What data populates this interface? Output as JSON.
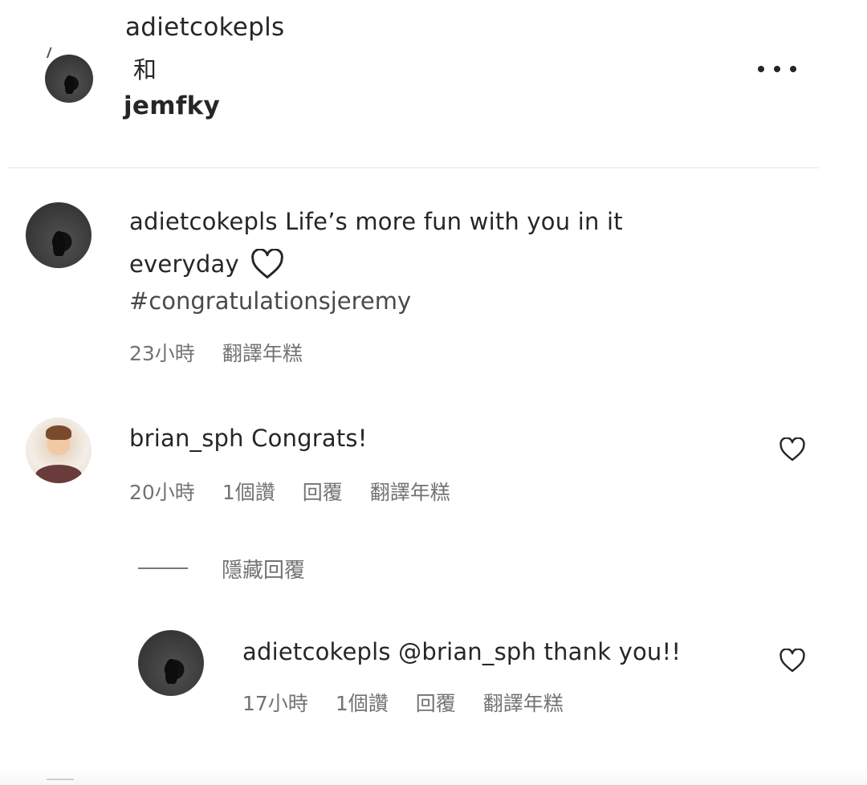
{
  "header": {
    "user1": "adietcokepls",
    "conjunction": "和",
    "user2": "jemfky",
    "more_icon": "more-horizontal-icon"
  },
  "comments": [
    {
      "username": "adietcokepls",
      "text_line1": "Life’s more fun with you in it",
      "text_line2": "everyday",
      "hashtag": "#congratulationsjeremy",
      "time": "23小時",
      "translate": "翻譯年糕"
    },
    {
      "username": "brian_sph",
      "text": "Congrats!",
      "time": "20小時",
      "likes": "1個讚",
      "reply": "回覆",
      "translate": "翻譯年糕",
      "heart_icon": "heart-outline-icon"
    }
  ],
  "hide_replies": "隱藏回覆",
  "reply": {
    "username": "adietcokepls",
    "text": "@brian_sph thank you!!",
    "time": "17小時",
    "likes": "1個讚",
    "reply": "回覆",
    "translate": "翻譯年糕",
    "heart_icon": "heart-outline-icon"
  }
}
